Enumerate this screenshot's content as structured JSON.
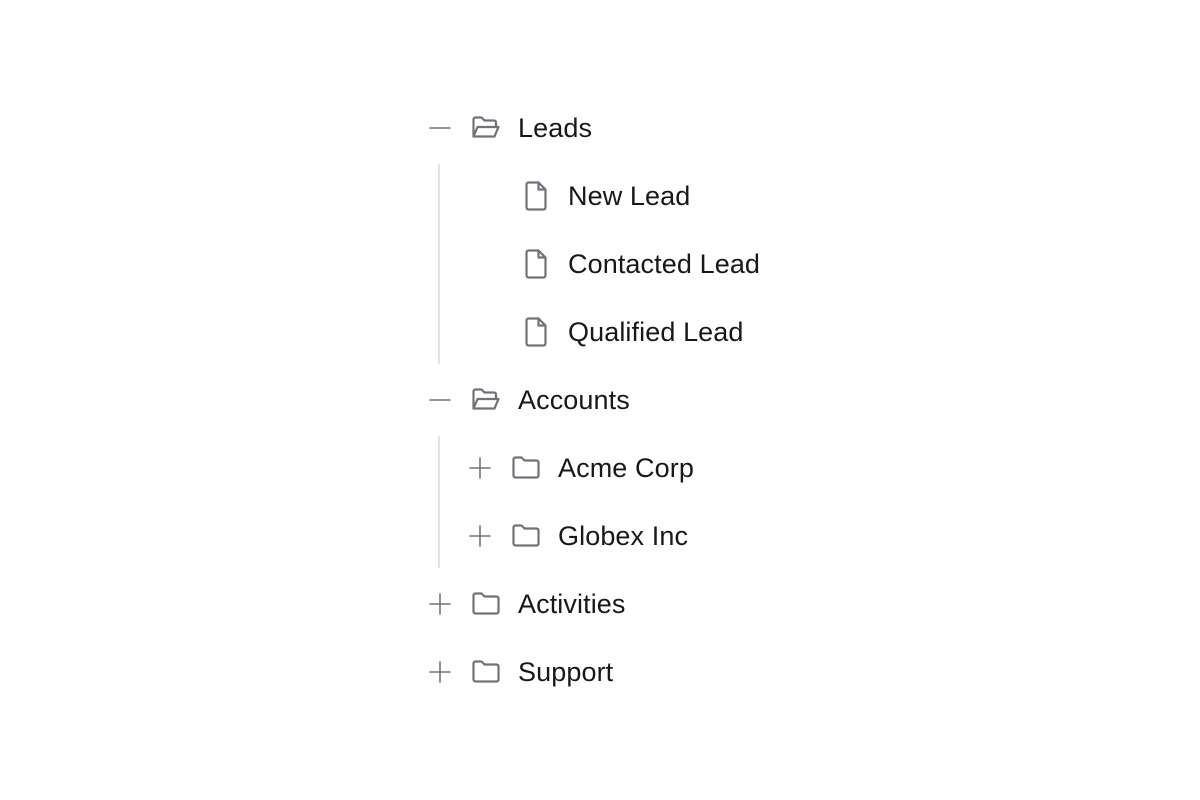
{
  "tree": {
    "leads": {
      "label": "Leads",
      "expanded": true,
      "toggle_icon": "minus-icon",
      "folder_icon": "folder-open-icon",
      "children": [
        {
          "label": "New Lead",
          "icon": "file-icon"
        },
        {
          "label": "Contacted Lead",
          "icon": "file-icon"
        },
        {
          "label": "Qualified Lead",
          "icon": "file-icon"
        }
      ]
    },
    "accounts": {
      "label": "Accounts",
      "expanded": true,
      "toggle_icon": "minus-icon",
      "folder_icon": "folder-open-icon",
      "children": [
        {
          "label": "Acme Corp",
          "icon": "folder-icon",
          "toggle_icon": "plus-icon",
          "expanded": false
        },
        {
          "label": "Globex Inc",
          "icon": "folder-icon",
          "toggle_icon": "plus-icon",
          "expanded": false
        }
      ]
    },
    "activities": {
      "label": "Activities",
      "expanded": false,
      "toggle_icon": "plus-icon",
      "folder_icon": "folder-icon"
    },
    "support": {
      "label": "Support",
      "expanded": false,
      "toggle_icon": "plus-icon",
      "folder_icon": "folder-icon"
    }
  },
  "colors": {
    "text": "#18181b",
    "icon": "#71717a",
    "guide_line": "#e4e4e7",
    "background": "#ffffff"
  }
}
